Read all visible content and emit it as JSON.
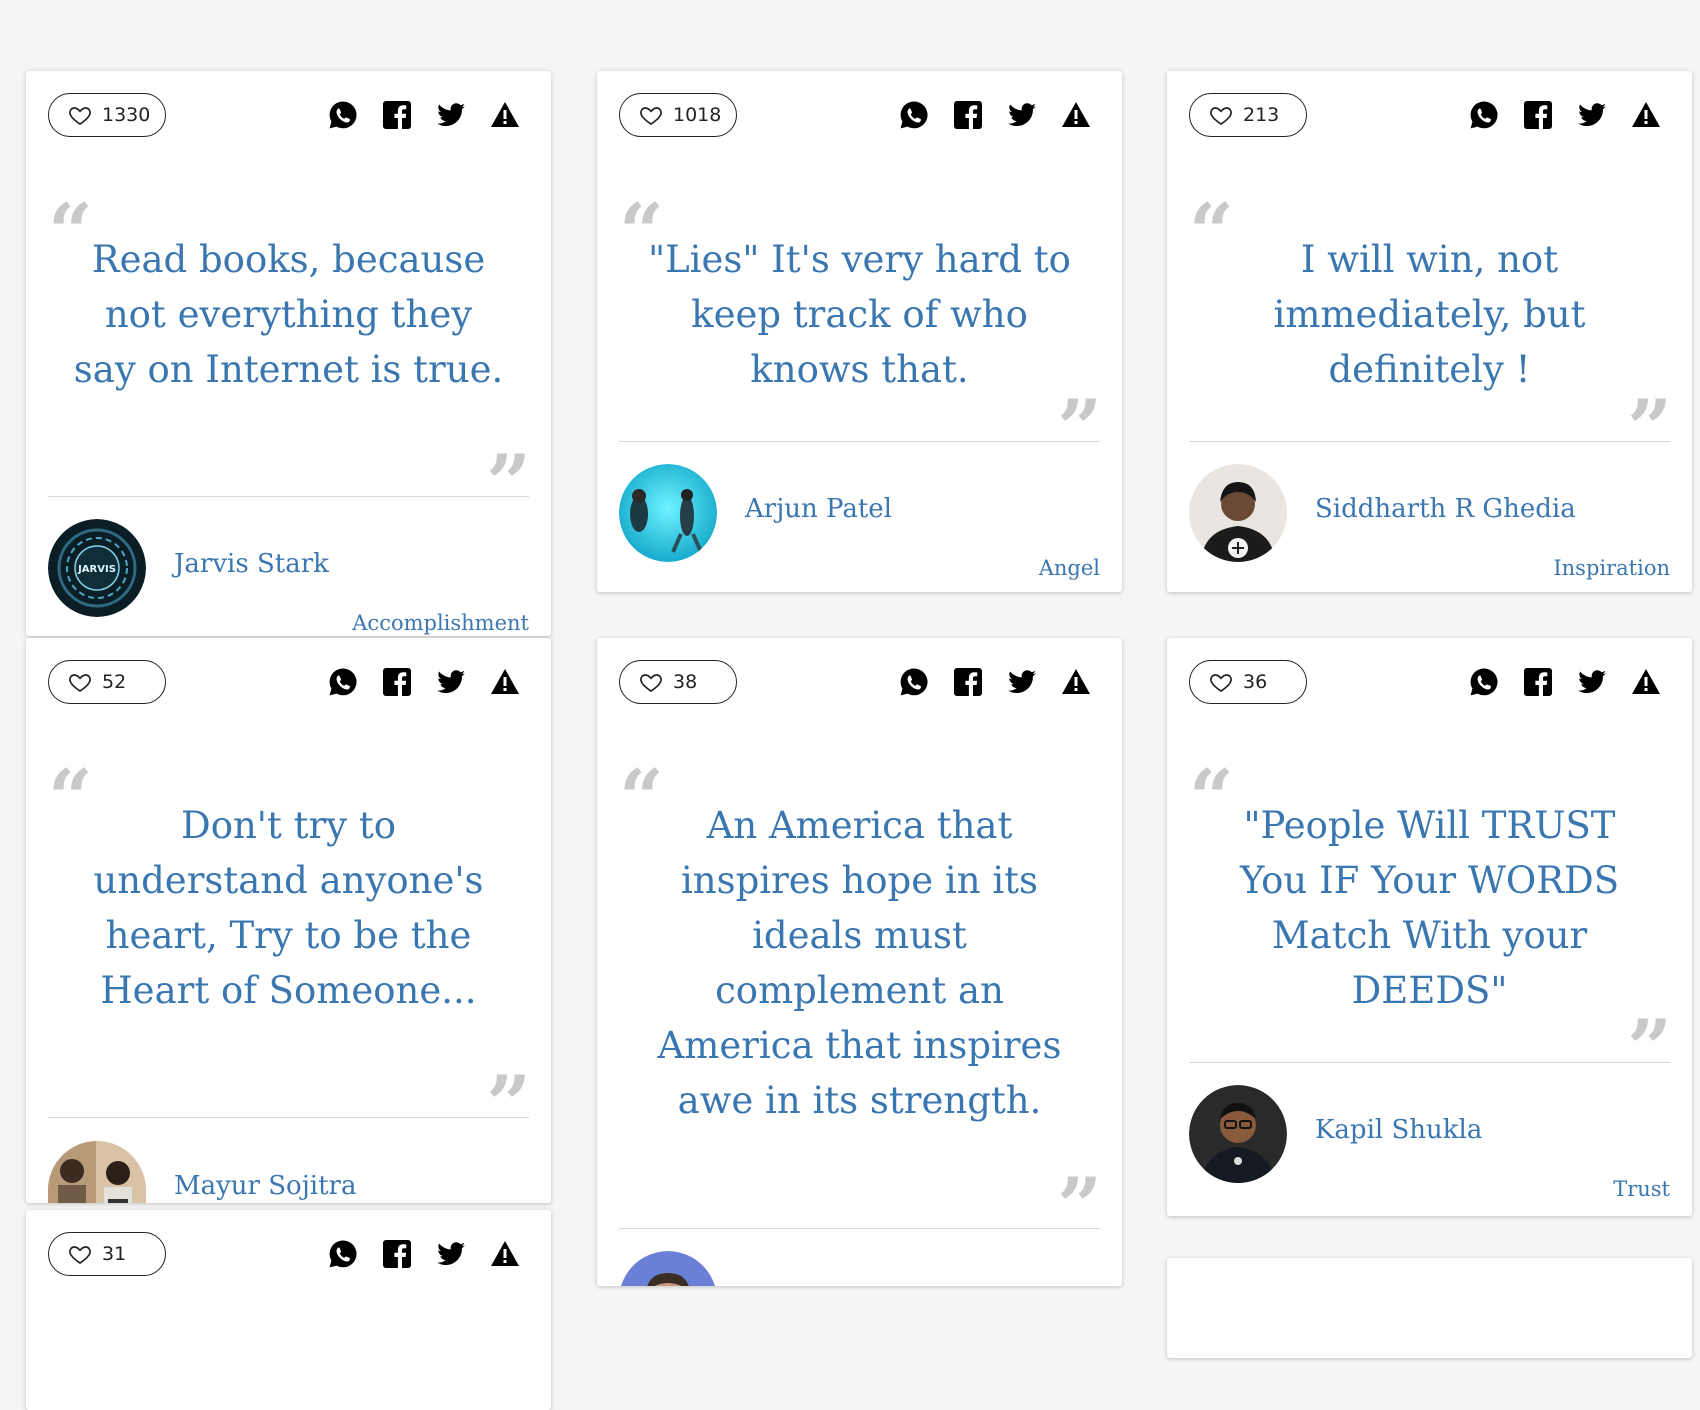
{
  "cards": [
    {
      "likes": "1330",
      "quote": "Read books, because not everything they say on Internet is true.",
      "author": "Jarvis Stark",
      "category": "Accomplishment",
      "avatar_label": "JARVIS"
    },
    {
      "likes": "1018",
      "quote": "\"Lies\" It's very hard to keep track of who knows that.",
      "author": "Arjun Patel",
      "category": "Angel"
    },
    {
      "likes": "213",
      "quote": "I will win, not immediately, but definitely !",
      "author": "Siddharth R Ghedia",
      "category": "Inspiration"
    },
    {
      "likes": "52",
      "quote": "Don't try to understand anyone's heart, Try to be the Heart of Someone...",
      "author": "Mayur Sojitra"
    },
    {
      "likes": "38",
      "quote": "An America that inspires hope in its ideals must complement an America that inspires awe in its strength."
    },
    {
      "likes": "36",
      "quote": "\"People Will TRUST You IF Your WORDS Match With your DEEDS\"",
      "author": "Kapil Shukla",
      "category": "Trust"
    },
    {
      "likes": "31"
    }
  ],
  "icons": {
    "like": "heart-outline-icon",
    "share": [
      "whatsapp-icon",
      "facebook-icon",
      "twitter-icon",
      "report-icon"
    ]
  },
  "colors": {
    "background": "#f5f5f5",
    "card": "#ffffff",
    "text_blue": "#3a76b0",
    "quote_mark": "#c9c9c9"
  }
}
